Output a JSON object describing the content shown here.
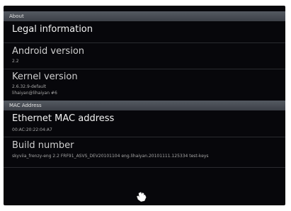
{
  "sections": {
    "about": {
      "header": "About"
    },
    "mac": {
      "header": "MAC Address"
    }
  },
  "items": {
    "legal": {
      "title": "Legal information"
    },
    "android": {
      "title": "Android version",
      "summary": "2.2"
    },
    "kernel": {
      "title": "Kernel version",
      "summary_line1": "2.6.32.9-default",
      "summary_line2": "lihaiyan@lihaiyan #6"
    },
    "ethernet": {
      "title": "Ethernet MAC address",
      "summary": "00:AC:20:22:04:A7"
    },
    "build": {
      "title": "Build number",
      "summary": "skyviia_frenzy-eng 2.2 FRF91_ASVS_DEV20101104 eng.lihaiyan.20101111.125334 test-keys"
    }
  },
  "cursor": {
    "icon": "hand-pointer-icon"
  }
}
